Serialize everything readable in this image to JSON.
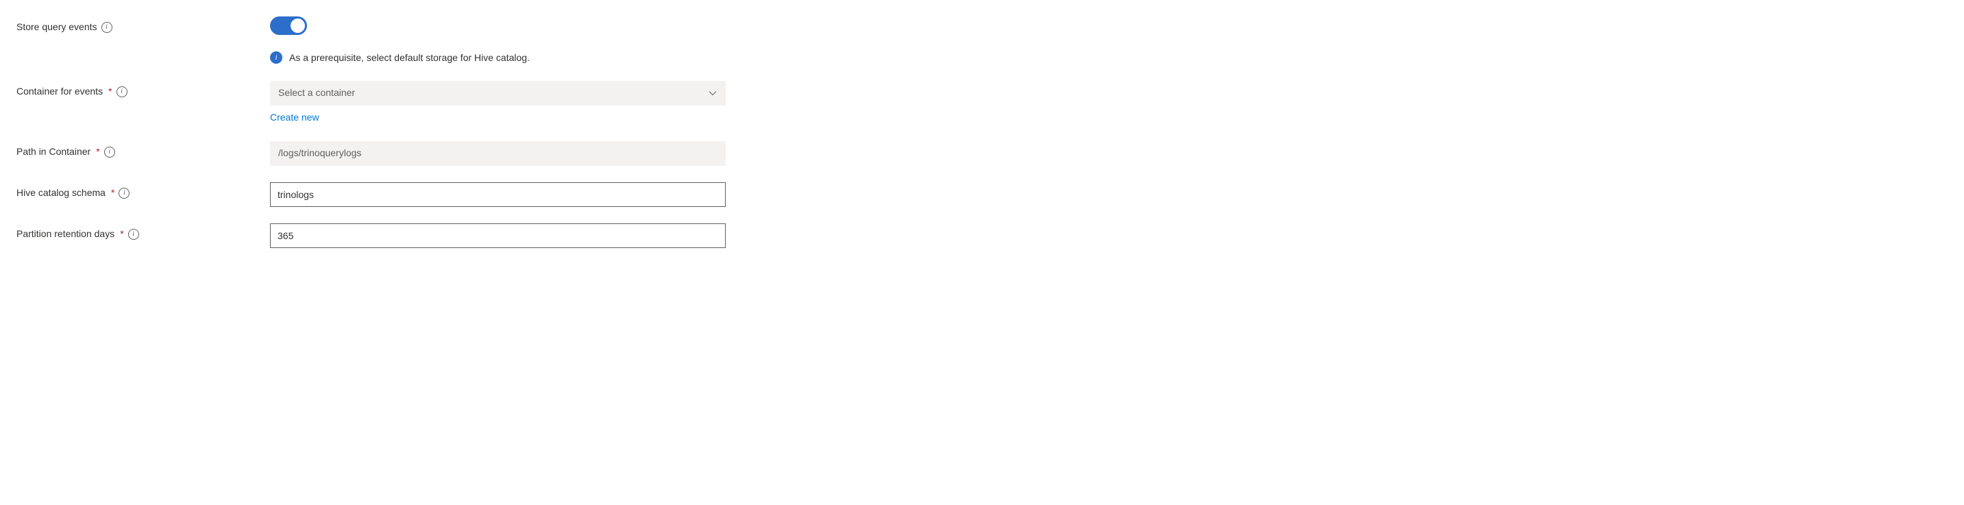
{
  "fields": {
    "storeQueryEvents": {
      "label": "Store query events",
      "enabled": true,
      "prerequisiteText": "As a prerequisite, select default storage for Hive catalog."
    },
    "containerForEvents": {
      "label": "Container for events",
      "placeholder": "Select a container",
      "createNewLink": "Create new"
    },
    "pathInContainer": {
      "label": "Path in Container",
      "value": "/logs/trinoquerylogs"
    },
    "hiveCatalogSchema": {
      "label": "Hive catalog schema",
      "value": "trinologs"
    },
    "partitionRetentionDays": {
      "label": "Partition retention days",
      "value": "365"
    }
  },
  "symbols": {
    "requiredMark": "*"
  }
}
